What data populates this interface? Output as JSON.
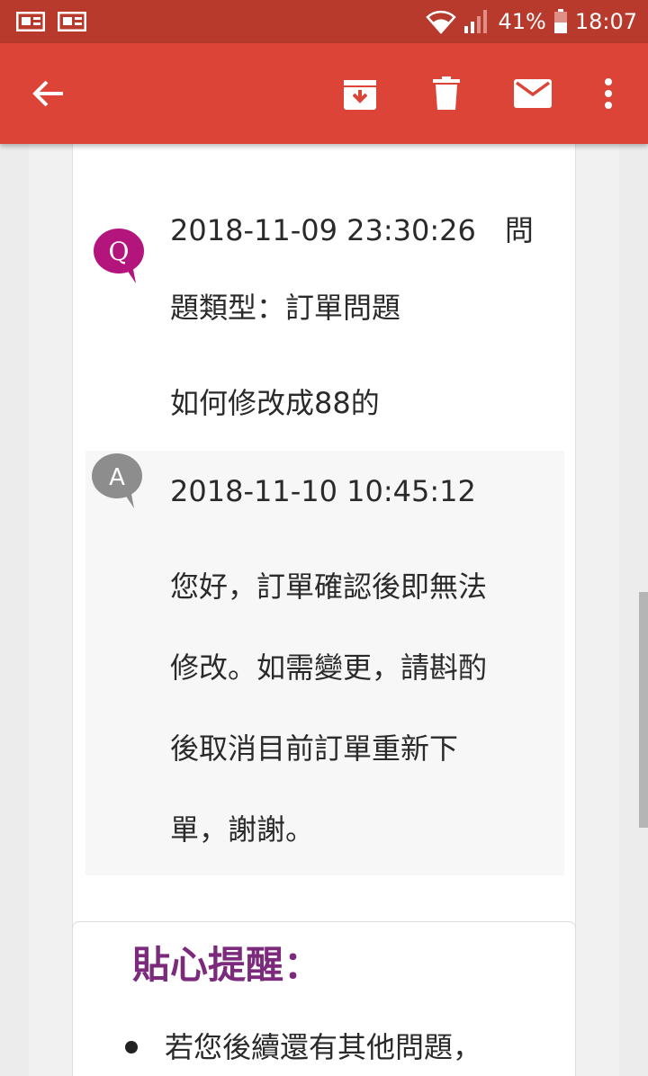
{
  "status_bar": {
    "battery_percent": "41%",
    "time": "18:07"
  },
  "app_bar": {
    "icons": [
      "back-arrow-icon",
      "archive-icon",
      "delete-icon",
      "mail-icon",
      "more-vert-icon"
    ]
  },
  "question": {
    "avatar_letter": "Q",
    "timestamp_line": "2018-11-09 23:30:26　問",
    "type_line": "題類型：訂單問題",
    "body": "如何修改成88的"
  },
  "answer": {
    "avatar_letter": "A",
    "timestamp": "2018-11-10 10:45:12",
    "lines": [
      "您好，訂單確認後即無法",
      "修改。如需變更，請斟酌",
      "後取消目前訂單重新下",
      "單，謝謝。"
    ]
  },
  "tips": {
    "title": "貼心提醒：",
    "items": [
      "若您後續還有其他問題，"
    ]
  },
  "colors": {
    "status_bar": "#b73a2c",
    "app_bar": "#dc4437",
    "q_avatar": "#b3157d",
    "a_avatar": "#8d8d8d",
    "tip_title": "#7b2a7c"
  }
}
